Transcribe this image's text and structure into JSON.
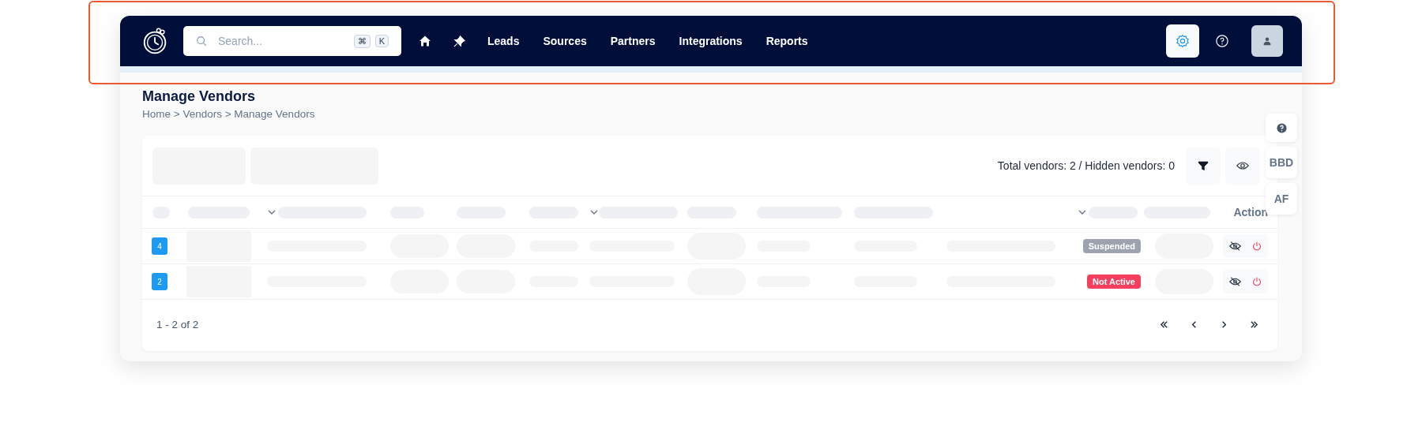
{
  "nav": {
    "search_placeholder": "Search...",
    "shortcut_keys": [
      "⌘",
      "K"
    ],
    "links": [
      {
        "label": "Leads"
      },
      {
        "label": "Sources"
      },
      {
        "label": "Partners"
      },
      {
        "label": "Integrations"
      },
      {
        "label": "Reports"
      }
    ],
    "icon_buttons": [
      {
        "kind": "settings",
        "selected": true
      },
      {
        "kind": "help",
        "selected": false
      }
    ]
  },
  "page": {
    "title": "Manage Vendors",
    "breadcrumb": "Home > Vendors > Manage Vendors"
  },
  "toolbar": {
    "summary": "Total vendors: 2 / Hidden vendors: 0"
  },
  "table": {
    "action_header": "Action",
    "rows": [
      {
        "id": "4",
        "status": "Suspended",
        "color": "#9ca3af"
      },
      {
        "id": "2",
        "status": "Not Active",
        "color": "#f43f5e"
      }
    ]
  },
  "pagination": {
    "range": "1 - 2 of 2"
  },
  "side_buttons": [
    {
      "kind": "help"
    },
    {
      "kind": "label",
      "label": "BBD"
    },
    {
      "kind": "label",
      "label": "AF"
    }
  ]
}
